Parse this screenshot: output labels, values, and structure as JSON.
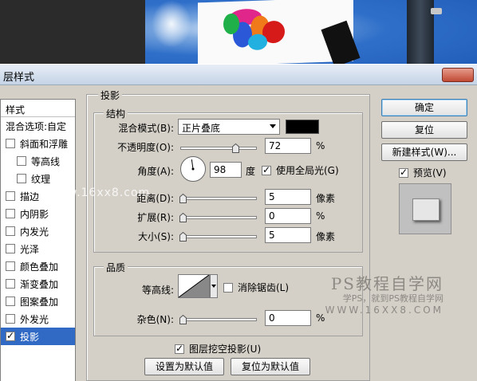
{
  "dialog": {
    "title": "层样式"
  },
  "stylelist": {
    "header": "样式",
    "blend_options": "混合选项:自定",
    "items": [
      {
        "label": "斜面和浮雕",
        "checked": false,
        "sub": false
      },
      {
        "label": "等高线",
        "checked": false,
        "sub": true
      },
      {
        "label": "纹理",
        "checked": false,
        "sub": true
      },
      {
        "label": "描边",
        "checked": false,
        "sub": false
      },
      {
        "label": "内阴影",
        "checked": false,
        "sub": false
      },
      {
        "label": "内发光",
        "checked": false,
        "sub": false
      },
      {
        "label": "光泽",
        "checked": false,
        "sub": false
      },
      {
        "label": "颜色叠加",
        "checked": false,
        "sub": false
      },
      {
        "label": "渐变叠加",
        "checked": false,
        "sub": false
      },
      {
        "label": "图案叠加",
        "checked": false,
        "sub": false
      },
      {
        "label": "外发光",
        "checked": false,
        "sub": false
      },
      {
        "label": "投影",
        "checked": true,
        "sub": false,
        "selected": true
      }
    ]
  },
  "shadow": {
    "section_title": "投影",
    "structure_title": "结构",
    "blend_mode_label": "混合模式(B):",
    "blend_mode_value": "正片叠底",
    "shadow_color": "#000000",
    "opacity_label": "不透明度(O):",
    "opacity_value": "72",
    "opacity_unit": "%",
    "opacity_fraction": 0.72,
    "angle_label": "角度(A):",
    "angle_value": "98",
    "angle_unit": "度",
    "global_light_label": "使用全局光(G)",
    "global_light_checked": true,
    "distance_label": "距离(D):",
    "distance_value": "5",
    "distance_unit": "像素",
    "spread_label": "扩展(R):",
    "spread_value": "0",
    "spread_unit": "%",
    "size_label": "大小(S):",
    "size_value": "5",
    "size_unit": "像素",
    "quality_title": "品质",
    "contour_label": "等高线:",
    "antialias_label": "消除锯齿(L)",
    "antialias_checked": false,
    "noise_label": "杂色(N):",
    "noise_value": "0",
    "noise_unit": "%",
    "knockout_label": "图层挖空投影(U)",
    "knockout_checked": true,
    "set_default_label": "设置为默认值",
    "reset_default_label": "复位为默认值"
  },
  "buttons": {
    "ok": "确定",
    "reset": "复位",
    "new_style": "新建样式(W)...",
    "preview_label": "预览(V)",
    "preview_checked": true
  },
  "watermarks": {
    "mid": "www.16xx8.com",
    "brand": "PS教程自学网",
    "slogan": "学PS，就到PS教程自学网",
    "url": "WWW.16XX8.COM"
  },
  "colors": {
    "selection": "#316ac5",
    "dialog_bg": "#d4d0c8"
  }
}
